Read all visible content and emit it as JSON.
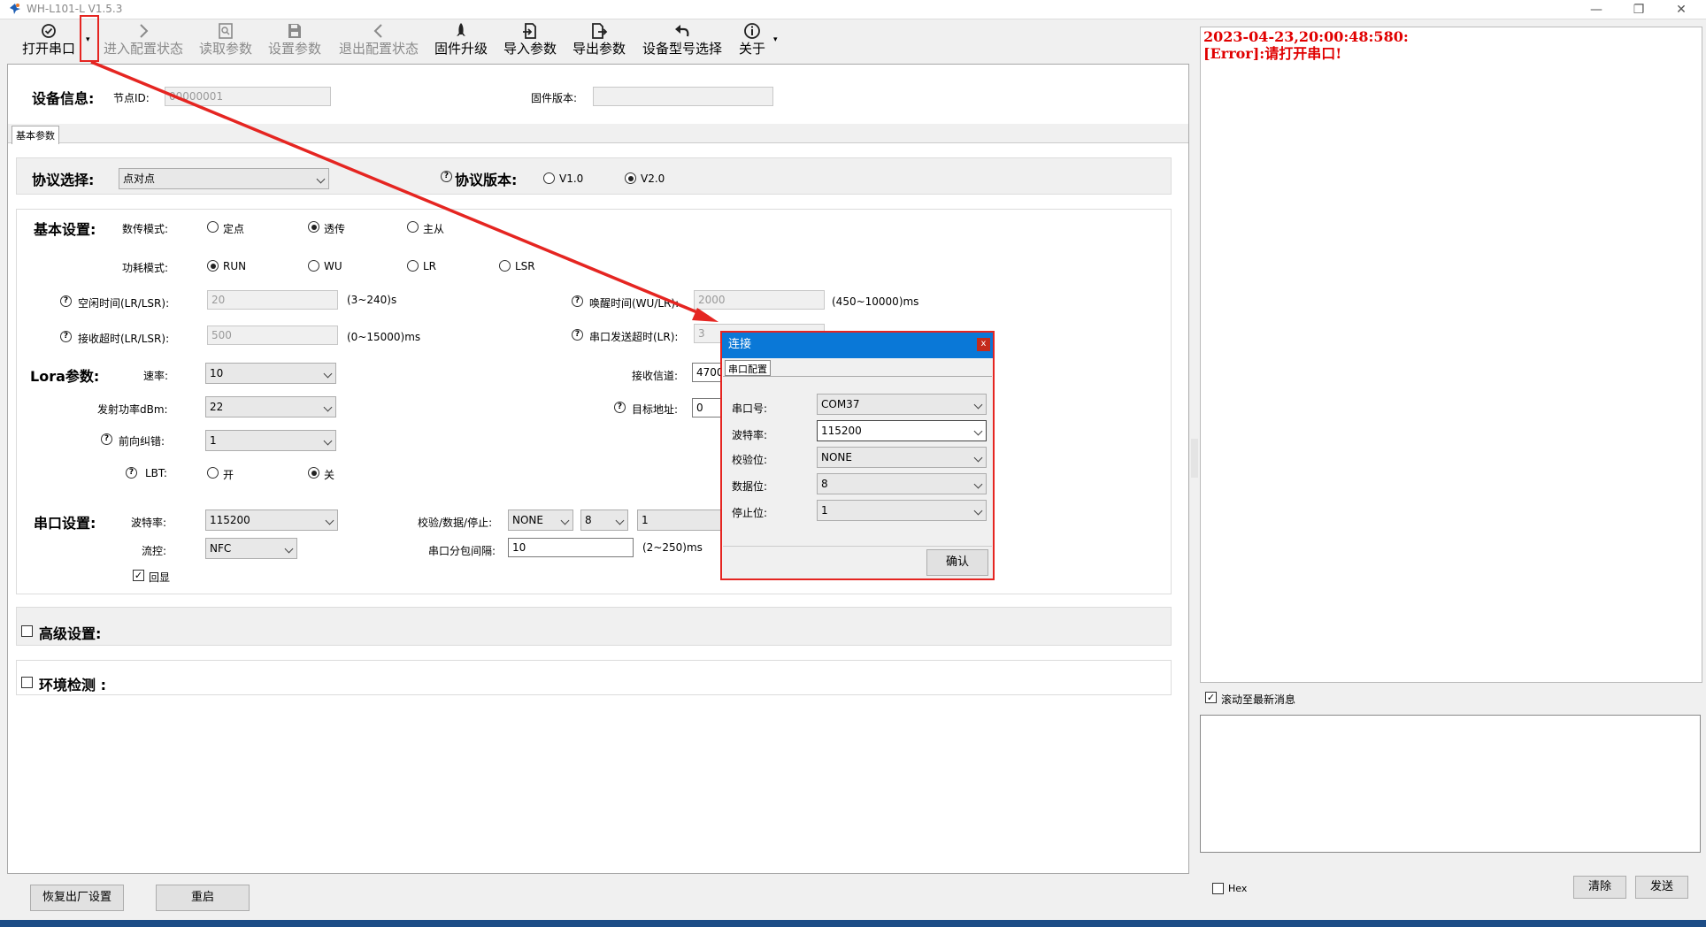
{
  "window": {
    "title": "WH-L101-L V1.5.3",
    "min_glyph": "—",
    "max_glyph": "❐",
    "close_glyph": "✕"
  },
  "toolbar": {
    "open_port": "打开串口",
    "enter_config": "进入配置状态",
    "read_params": "读取参数",
    "set_params": "设置参数",
    "exit_config": "退出配置状态",
    "firmware_upgrade": "固件升级",
    "import_params": "导入参数",
    "export_params": "导出参数",
    "device_model": "设备型号选择",
    "about": "关于",
    "caret": "▾"
  },
  "device_info": {
    "header": "设备信息:",
    "node_id_label": "节点ID:",
    "node_id_value": "00000001",
    "fw_version_label": "固件版本:",
    "fw_version_value": ""
  },
  "tab": {
    "basic": "基本参数"
  },
  "protocol": {
    "header": "协议选择:",
    "selected": "点对点",
    "version_header": "协议版本:",
    "v1": "V1.0",
    "v2": "V2.0"
  },
  "basic": {
    "header": "基本设置:",
    "transfer_mode_label": "数传模式:",
    "mode_fixed": "定点",
    "mode_transparent": "透传",
    "mode_master": "主从",
    "power_mode_label": "功耗模式:",
    "pm_run": "RUN",
    "pm_wu": "WU",
    "pm_lr": "LR",
    "pm_lsr": "LSR",
    "idle_label": "空闲时间(LR/LSR):",
    "idle_value": "20",
    "idle_range": "(3~240)s",
    "wake_label": "唤醒时间(WU/LR):",
    "wake_value": "2000",
    "wake_range": "(450~10000)ms",
    "recv_timeout_label": "接收超时(LR/LSR):",
    "recv_timeout_value": "500",
    "recv_timeout_range": "(0~15000)ms",
    "uart_timeout_label": "串口发送超时(LR):",
    "uart_timeout_value": "3"
  },
  "lora": {
    "header": "Lora参数:",
    "rate_label": "速率:",
    "rate_value": "10",
    "power_label": "发射功率dBm:",
    "power_value": "22",
    "fec_label": "前向纠错:",
    "fec_value": "1",
    "lbt_label": "LBT:",
    "lbt_on": "开",
    "lbt_off": "关",
    "channel_label": "接收信道:",
    "channel_value": "4700",
    "target_label": "目标地址:",
    "target_value": "0"
  },
  "serial": {
    "header": "串口设置:",
    "baud_label": "波特率:",
    "baud_value": "115200",
    "flow_label": "流控:",
    "flow_value": "NFC",
    "echo_label": "回显",
    "parity_label": "校验/数据/停止:",
    "parity_value": "NONE",
    "data_value": "8",
    "stop_value": "1",
    "packet_label": "串口分包间隔:",
    "packet_value": "10",
    "packet_range": "(2~250)ms"
  },
  "advanced": {
    "header": "高级设置:"
  },
  "env": {
    "header": "环境检测 :"
  },
  "buttons": {
    "factory_reset": "恢复出厂设置",
    "restart": "重启"
  },
  "log": {
    "line1": "2023-04-23,20:00:48:580:",
    "line2": "[Error]:请打开串口!"
  },
  "scroll_latest": "滚动至最新消息",
  "hex_label": "Hex",
  "clear_button": "清除",
  "send_button": "发送",
  "dialog": {
    "title": "连接",
    "close": "x",
    "tab": "串口配置",
    "port_label": "串口号:",
    "port_value": "COM37",
    "baud_label": "波特率:",
    "baud_value": "115200",
    "parity_label": "校验位:",
    "parity_value": "NONE",
    "data_label": "数据位:",
    "data_value": "8",
    "stop_label": "停止位:",
    "stop_value": "1",
    "confirm": "确认"
  },
  "colors": {
    "accent": "#0a78d7",
    "annotation_red": "#e52521",
    "log_error": "#e00000"
  }
}
